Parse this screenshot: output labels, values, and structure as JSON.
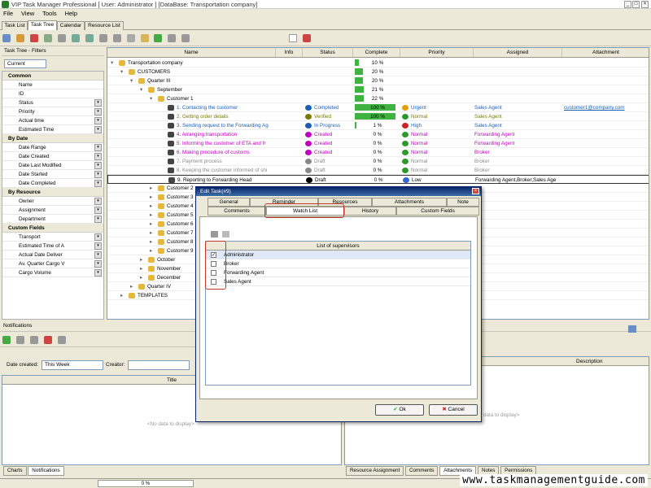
{
  "window": {
    "title": "VIP Task Manager Professional [ User: Administrator ] [DataBase: Transportation company]"
  },
  "menu": [
    "File",
    "View",
    "Tools",
    "Help"
  ],
  "main_tabs": [
    "Task List",
    "Task Tree",
    "Calendar",
    "Resource List"
  ],
  "filters": {
    "title": "Task Tree - Filters",
    "current": "Current",
    "sections": [
      {
        "label": "Common",
        "items": [
          "Name",
          "ID",
          "Status",
          "Priority",
          "Actual time",
          "Estimated Time"
        ]
      },
      {
        "label": "By Date",
        "items": [
          "Date Range",
          "Date Created",
          "Date Last Modified",
          "Date Started",
          "Date Completed"
        ]
      },
      {
        "label": "By Resource",
        "items": [
          "Owner",
          "Assignment",
          "Department"
        ]
      },
      {
        "label": "Custom Fields",
        "items": [
          "Transport",
          "Estimated Time of A",
          "Actual Date Deliver",
          "Av. Quarter Cargo V",
          "Cargo Volume"
        ]
      }
    ]
  },
  "grid": {
    "columns": [
      "Name",
      "Info",
      "Status",
      "Complete",
      "Priority",
      "Assigned",
      "Attachment"
    ],
    "rows": [
      {
        "name": "Transportation company",
        "indent": 0,
        "complete": "10 %",
        "pct": 10
      },
      {
        "name": "CUSTOMERS",
        "indent": 1,
        "complete": "20 %",
        "pct": 20
      },
      {
        "name": "Quarter III",
        "indent": 2,
        "complete": "20 %",
        "pct": 20
      },
      {
        "name": "September",
        "indent": 3,
        "complete": "21 %",
        "pct": 21
      },
      {
        "name": "Customer 1",
        "indent": 4,
        "complete": "22 %",
        "pct": 22
      },
      {
        "name": "1. Contacting the customer",
        "indent": 5,
        "status": "Completed",
        "complete": "100 %",
        "pct": 100,
        "priority": "Urgent",
        "assigned": "Sales Agent",
        "attachment": "customer1@company.com",
        "color": "#1a5fb4"
      },
      {
        "name": "2. Getting order details",
        "indent": 5,
        "status": "Verified",
        "complete": "100 %",
        "pct": 100,
        "priority": "Normal",
        "assigned": "Sales Agent",
        "color": "#7a7a00"
      },
      {
        "name": "3. Sending request to the Forwarding Ag",
        "indent": 5,
        "status": "In Progress",
        "complete": "1 %",
        "pct": 1,
        "priority": "High",
        "assigned": "Sales Agent",
        "color": "#1a5fb4"
      },
      {
        "name": "4. Arranging transportation",
        "indent": 5,
        "status": "Created",
        "complete": "0 %",
        "pct": 0,
        "priority": "Normal",
        "assigned": "Forwarding Agent",
        "color": "#c000c0"
      },
      {
        "name": "5. Informing the customer of ETA and fr",
        "indent": 5,
        "status": "Created",
        "complete": "0 %",
        "pct": 0,
        "priority": "Normal",
        "assigned": "Forwarding Agent",
        "color": "#c000c0"
      },
      {
        "name": "6. Making procedure of customs",
        "indent": 5,
        "status": "Created",
        "complete": "0 %",
        "pct": 0,
        "priority": "Normal",
        "assigned": "Broker",
        "color": "#c000c0"
      },
      {
        "name": "7. Payment process",
        "indent": 5,
        "status": "Draft",
        "complete": "0 %",
        "pct": 0,
        "priority": "Normal",
        "assigned": "Broker",
        "color": "#888888"
      },
      {
        "name": "8. Keeping the customer informed of shi",
        "indent": 5,
        "status": "Draft",
        "complete": "0 %",
        "pct": 0,
        "priority": "Normal",
        "assigned": "Broker",
        "color": "#888888"
      },
      {
        "name": "9. Reporting to Forwarding Head",
        "indent": 5,
        "status": "Draft",
        "complete": "0 %",
        "pct": 0,
        "priority": "Low",
        "assigned": "Forwarding Agent,Broker,Sales Age",
        "color": "#000000"
      },
      {
        "name": "Customer 2",
        "indent": 4
      },
      {
        "name": "Customer 3",
        "indent": 4
      },
      {
        "name": "Customer 4",
        "indent": 4
      },
      {
        "name": "Customer 5",
        "indent": 4
      },
      {
        "name": "Customer 6",
        "indent": 4
      },
      {
        "name": "Customer 7",
        "indent": 4
      },
      {
        "name": "Customer 8",
        "indent": 4
      },
      {
        "name": "Customer 9",
        "indent": 4
      },
      {
        "name": "October",
        "indent": 3
      },
      {
        "name": "November",
        "indent": 3
      },
      {
        "name": "December",
        "indent": 3
      },
      {
        "name": "Quarter IV",
        "indent": 2
      },
      {
        "name": "TEMPLATES",
        "indent": 1
      }
    ]
  },
  "dialog": {
    "title": "Edit Task(#9)",
    "tabs_row1": [
      "General",
      "Reminder",
      "Resources",
      "Attachments",
      "Note"
    ],
    "tabs_row2": [
      "Comments",
      "Watch List",
      "History",
      "Custom Fields"
    ],
    "list_header": "List of supervisors",
    "supervisors": [
      {
        "name": "Administrator",
        "checked": true
      },
      {
        "name": "Broker",
        "checked": false
      },
      {
        "name": "Forwarding Agent",
        "checked": false
      },
      {
        "name": "Sales Agent",
        "checked": false
      }
    ],
    "ok": "Ok",
    "cancel": "Cancel"
  },
  "notifications": {
    "title": "Notifications",
    "date_created_label": "Date created:",
    "date_created_value": "This Week",
    "creator_label": "Creator:",
    "title_col": "Title",
    "empty": "<No data to display>",
    "tabs": [
      "Charts",
      "Notifications"
    ]
  },
  "right_panel": {
    "description_col": "Description",
    "empty": "data to display>",
    "tabs": [
      "Resource Assignment",
      "Comments",
      "Attachments",
      "Notes",
      "Permissions"
    ]
  },
  "status": {
    "progress": "0 %"
  },
  "watermark": "www.taskmanagementguide.com"
}
